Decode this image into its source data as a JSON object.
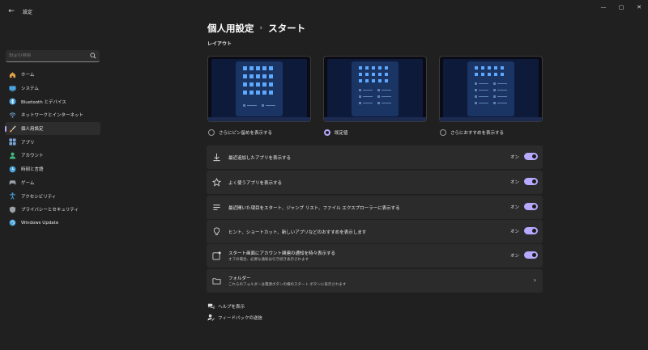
{
  "window": {
    "back_glyph": "←",
    "title": "設定",
    "controls": {
      "minimize": "—",
      "maximize": "▢",
      "close": "✕"
    }
  },
  "sidebar": {
    "search_placeholder": "設定の検索",
    "items": [
      {
        "label": "ホーム",
        "icon": "home-icon",
        "color": "#e0a34a"
      },
      {
        "label": "システム",
        "icon": "system-icon",
        "color": "#4aa3df"
      },
      {
        "label": "Bluetooth とデバイス",
        "icon": "bluetooth-icon",
        "color": "#4aa3df"
      },
      {
        "label": "ネットワークとインターネット",
        "icon": "network-icon",
        "color": "#7bb8e8"
      },
      {
        "label": "個人用設定",
        "icon": "brush-icon",
        "color": "#e8a050",
        "active": true
      },
      {
        "label": "アプリ",
        "icon": "apps-icon",
        "color": "#7aa7d8"
      },
      {
        "label": "アカウント",
        "icon": "account-icon",
        "color": "#3fbf7f"
      },
      {
        "label": "時刻と言語",
        "icon": "time-language-icon",
        "color": "#4aa3df"
      },
      {
        "label": "ゲーム",
        "icon": "gaming-icon",
        "color": "#9aa0a6"
      },
      {
        "label": "アクセシビリティ",
        "icon": "accessibility-icon",
        "color": "#4aa3df"
      },
      {
        "label": "プライバシーとセキュリティ",
        "icon": "shield-icon",
        "color": "#9aa0a6"
      },
      {
        "label": "Windows Update",
        "icon": "windows-update-icon",
        "color": "#4aa3df"
      }
    ]
  },
  "main": {
    "breadcrumb_parent": "個人用設定",
    "breadcrumb_sep": "›",
    "breadcrumb_current": "スタート",
    "section_label": "レイアウト",
    "layouts": [
      {
        "label": "さらにピン留めを表示する",
        "selected": false
      },
      {
        "label": "既定値",
        "selected": true
      },
      {
        "label": "さらにおすすめを表示する",
        "selected": false
      }
    ],
    "settings": [
      {
        "title": "最近追加したアプリを表示する",
        "subtitle": "",
        "icon": "download-icon",
        "state": "オン"
      },
      {
        "title": "よく使うアプリを表示する",
        "subtitle": "",
        "icon": "star-icon",
        "state": "オン"
      },
      {
        "title": "最近開いた項目をスタート、ジャンプ リスト、ファイル エクスプローラーに表示する",
        "subtitle": "",
        "icon": "list-icon",
        "state": "オン"
      },
      {
        "title": "ヒント、ショートカット、新しいアプリなどのおすすめを表示します",
        "subtitle": "",
        "icon": "lightbulb-icon",
        "state": "オン"
      },
      {
        "title": "スタート画面にアカウント関連の通知を時々表示する",
        "subtitle": "オフの場合、必要な通知は引き続き表示されます",
        "icon": "notification-icon",
        "state": "オン"
      }
    ],
    "folders": {
      "title": "フォルダー",
      "subtitle": "これらのフォルダーは電源ボタンの横のスタート ボタンに表示されます",
      "icon": "folder-icon",
      "chevron": "›"
    },
    "links": [
      {
        "label": "ヘルプを表示",
        "icon": "help-icon"
      },
      {
        "label": "フィードバックの送信",
        "icon": "feedback-icon"
      }
    ]
  }
}
